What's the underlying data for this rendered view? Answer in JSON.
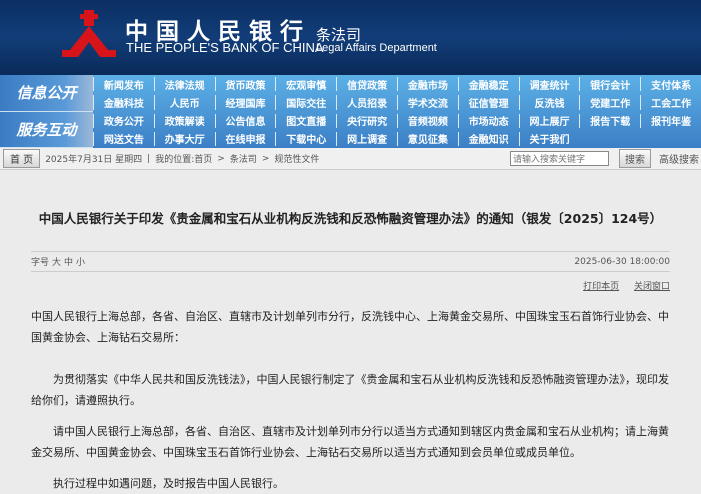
{
  "header": {
    "bank_cn": "中国人民银行",
    "bank_en": "THE PEOPLE'S BANK OF CHINA",
    "dept_cn": "条法司",
    "dept_en": "Legal Affairs Department"
  },
  "nav": {
    "labels": [
      "信息公开",
      "服务互动"
    ],
    "rows": [
      [
        "新闻发布",
        "法律法规",
        "货币政策",
        "宏观审慎",
        "信贷政策",
        "金融市场",
        "金融稳定",
        "调查统计",
        "银行会计",
        "支付体系"
      ],
      [
        "金融科技",
        "人民币",
        "经理国库",
        "国际交往",
        "人员招录",
        "学术交流",
        "征信管理",
        "反洗钱",
        "党建工作",
        "工会工作"
      ],
      [
        "政务公开",
        "政策解读",
        "公告信息",
        "图文直播",
        "央行研究",
        "音频视频",
        "市场动态",
        "网上展厅",
        "报告下载",
        "报刊年鉴"
      ],
      [
        "网送文告",
        "办事大厅",
        "在线申报",
        "下载中心",
        "网上调查",
        "意见征集",
        "金融知识",
        "关于我们"
      ]
    ]
  },
  "crumb": {
    "home": "首 页",
    "date": "2025年7月31日 星期四",
    "location_label": "我的位置:",
    "items": [
      "首页",
      "条法司",
      "规范性文件"
    ],
    "sep": ">",
    "divider": "|",
    "search_placeholder": "请输入搜索关键字",
    "search_btn": "搜索",
    "advanced": "高级搜索"
  },
  "article": {
    "title": "中国人民银行关于印发《贵金属和宝石从业机构反洗钱和反恐怖融资管理办法》的通知（银发〔2025〕124号）",
    "font_label": "字号",
    "font_sizes": [
      "大",
      "中",
      "小"
    ],
    "date": "2025-06-30 18:00:00",
    "print": "打印本页",
    "close": "关闭窗口",
    "paragraphs": [
      "中国人民银行上海总部，各省、自治区、直辖市及计划单列市分行，反洗钱中心、上海黄金交易所、中国珠宝玉石首饰行业协会、中国黄金协会、上海钻石交易所：",
      "为贯彻落实《中华人民共和国反洗钱法》，中国人民银行制定了《贵金属和宝石从业机构反洗钱和反恐怖融资管理办法》，现印发给你们，请遵照执行。",
      "请中国人民银行上海总部，各省、自治区、直辖市及计划单列市分行以适当方式通知到辖区内贵金属和宝石从业机构；请上海黄金交易所、中国黄金协会、中国珠宝玉石首饰行业协会、上海钻石交易所以适当方式通知到会员单位或成员单位。",
      "执行过程中如遇问题，及时报告中国人民银行。"
    ]
  }
}
